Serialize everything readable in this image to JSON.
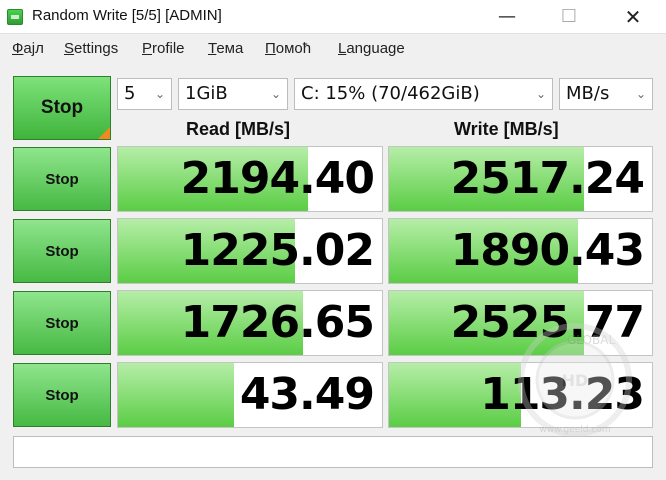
{
  "window": {
    "title": "Random Write [5/5] [ADMIN]",
    "controls": {
      "minimize": "—",
      "maximize": "☐",
      "close": "✕"
    }
  },
  "menu": [
    {
      "accel": "Ф",
      "rest": "ајл"
    },
    {
      "accel": "S",
      "rest": "ettings"
    },
    {
      "accel": "P",
      "rest": "rofile"
    },
    {
      "accel": "Т",
      "rest": "ема"
    },
    {
      "accel": "П",
      "rest": "омоћ"
    },
    {
      "accel": "L",
      "rest": "anguage"
    }
  ],
  "controls": {
    "main_stop": "Stop",
    "count": "5",
    "size": "1GiB",
    "drive": "C: 15% (70/462GiB)",
    "unit": "MB/s"
  },
  "headers": {
    "read": "Read [MB/s]",
    "write": "Write [MB/s]"
  },
  "tests": [
    {
      "label": "Stop",
      "read": "2194.40",
      "write": "2517.24",
      "read_fill": 0.72,
      "write_fill": 0.74
    },
    {
      "label": "Stop",
      "read": "1225.02",
      "write": "1890.43",
      "read_fill": 0.67,
      "write_fill": 0.72
    },
    {
      "label": "Stop",
      "read": "1726.65",
      "write": "2525.77",
      "read_fill": 0.7,
      "write_fill": 0.74
    },
    {
      "label": "Stop",
      "read": "43.49",
      "write": "113.23",
      "read_fill": 0.44,
      "write_fill": 0.5
    }
  ],
  "comment": "",
  "watermark": {
    "top": "GLOBAL",
    "mid": "HD",
    "bottom": "www.geeld.com"
  }
}
